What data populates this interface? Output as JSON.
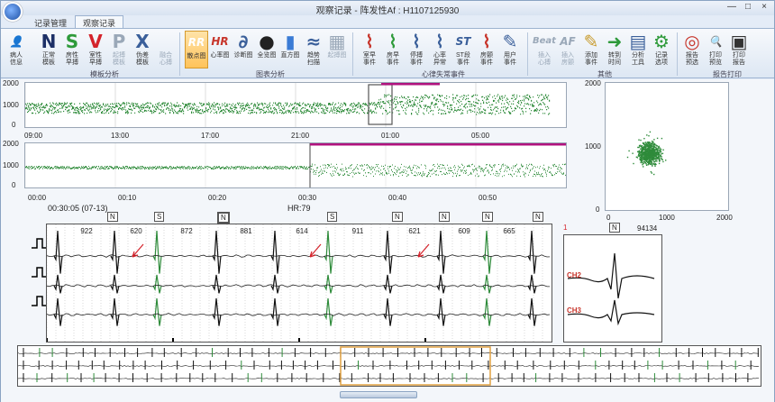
{
  "window": {
    "title": "观察记录 - 阵发性Af : H1107125930",
    "controls": [
      "—",
      "□",
      "×"
    ]
  },
  "tabs": [
    {
      "label": "记录管理",
      "active": false
    },
    {
      "label": "观察记录",
      "active": true
    }
  ],
  "ribbon": {
    "buttons": [
      {
        "id": "patient",
        "label": "病人\n信息",
        "glyph": "👤",
        "color": "#2a5fa8"
      },
      {
        "id": "normal",
        "label": "正常\n模板",
        "glyph": "N",
        "color": "#1c2f66"
      },
      {
        "id": "svpb",
        "label": "房性\n早搏",
        "glyph": "S",
        "color": "#2e9a3a"
      },
      {
        "id": "vpb",
        "label": "室性\n早搏",
        "glyph": "V",
        "color": "#d4232b"
      },
      {
        "id": "pace",
        "label": "起搏\n模板",
        "glyph": "P",
        "color": "#9aa8b8",
        "disabled": true
      },
      {
        "id": "artifact",
        "label": "伪差\n模板",
        "glyph": "X",
        "color": "#3a5f9a"
      },
      {
        "id": "fusion",
        "label": "融合\n心搏",
        "glyph": "",
        "color": "#9aa8b8",
        "disabled": true
      },
      {
        "id": "scatter",
        "label": "散点图",
        "glyph": "RR",
        "color": "#ffffff",
        "selected": true
      },
      {
        "id": "hr",
        "label": "心率图",
        "glyph": "HR",
        "color": "#c7352b"
      },
      {
        "id": "diag",
        "label": "诊断图",
        "glyph": "∂",
        "color": "#3a5f9a"
      },
      {
        "id": "full",
        "label": "全览图",
        "glyph": "●",
        "color": "#222222"
      },
      {
        "id": "hist",
        "label": "直方图",
        "glyph": "▮",
        "color": "#3a7bd5"
      },
      {
        "id": "trend",
        "label": "趋势\n扫描",
        "glyph": "≈",
        "color": "#3a5f9a"
      },
      {
        "id": "fluct",
        "label": "起搏图",
        "glyph": "▦",
        "color": "#9aa8b8",
        "disabled": true
      },
      {
        "id": "af_ev",
        "label": "室早\n事件",
        "glyph": "⌇",
        "color": "#c7352b"
      },
      {
        "id": "ap_ev",
        "label": "房早\n事件",
        "glyph": "⌇",
        "color": "#2e9a3a"
      },
      {
        "id": "pause_ev",
        "label": "停搏\n事件",
        "glyph": "⌇",
        "color": "#3a5f9a"
      },
      {
        "id": "arr_ev",
        "label": "心率\n异常",
        "glyph": "⌇",
        "color": "#3a5f9a"
      },
      {
        "id": "st_ev",
        "label": "ST段\n事件",
        "glyph": "ST",
        "color": "#3a5f9a"
      },
      {
        "id": "af2_ev",
        "label": "房颤\n事件",
        "glyph": "⌇",
        "color": "#c7352b"
      },
      {
        "id": "user_ev",
        "label": "用户\n事件",
        "glyph": "✎",
        "color": "#3a5f9a"
      },
      {
        "id": "beat",
        "label": "插入\n心搏",
        "glyph": "Beat",
        "color": "#9aa8b8",
        "disabled": true
      },
      {
        "id": "af_ins",
        "label": "插入\n房颤",
        "glyph": "AF",
        "color": "#9aa8b8",
        "disabled": true
      },
      {
        "id": "add_ev",
        "label": "添加\n事件",
        "glyph": "✎",
        "color": "#c79a2b"
      },
      {
        "id": "goto",
        "label": "转到\n时间",
        "glyph": "➜",
        "color": "#2e9a3a"
      },
      {
        "id": "tools",
        "label": "分析\n工具",
        "glyph": "▤",
        "color": "#3a5f9a"
      },
      {
        "id": "opts",
        "label": "记录\n选项",
        "glyph": "⚙",
        "color": "#2e9a3a"
      },
      {
        "id": "rpt_prev",
        "label": "报告\n预选",
        "glyph": "◎",
        "color": "#c7352b"
      },
      {
        "id": "print_prev",
        "label": "打印\n预览",
        "glyph": "🔍",
        "color": "#3a5f9a"
      },
      {
        "id": "print",
        "label": "打印\n报告",
        "glyph": "▣",
        "color": "#333333"
      }
    ],
    "groups": [
      "模板分析",
      "图表分析",
      "心律失常事件",
      "其他",
      "报告打印"
    ]
  },
  "trend1": {
    "yticks": [
      "2000",
      "1000",
      "0"
    ],
    "xticks": [
      "09:00",
      "13:00",
      "17:00",
      "21:00",
      "01:00",
      "05:00"
    ]
  },
  "trend2": {
    "yticks": [
      "2000",
      "1000",
      "0"
    ],
    "xticks": [
      "00:00",
      "00:10",
      "00:20",
      "00:30",
      "00:40",
      "00:50"
    ]
  },
  "status": {
    "time": "00:30:05 (07-13)",
    "hr": "HR:79"
  },
  "scatter": {
    "yticks": [
      "2000",
      "1000",
      "0"
    ],
    "xticks": [
      "0",
      "1000",
      "2000"
    ],
    "count": "94134",
    "beat_tag": "N"
  },
  "ecg": {
    "beat_labels": [
      "N",
      "S",
      "N",
      "S",
      "N",
      "N",
      "N",
      "N",
      "N"
    ],
    "rr_values": [
      "922",
      "620",
      "872",
      "881",
      "614",
      "911",
      "621",
      "609",
      "665"
    ],
    "page_num": "1"
  },
  "template": {
    "ch2": "CH2",
    "ch3": "CH3"
  },
  "colors": {
    "trace_green": "#2e8b3a",
    "magenta": "#b0127e",
    "marker_red": "#d4232b",
    "window_orange": "#e0a040"
  }
}
